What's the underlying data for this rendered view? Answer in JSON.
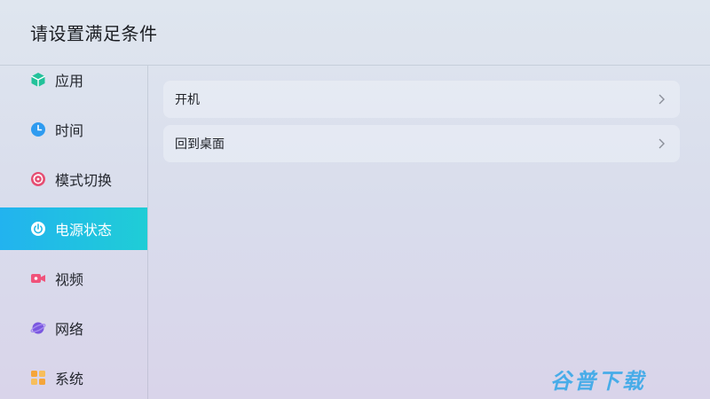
{
  "page": {
    "title": "请设置满足条件"
  },
  "sidebar": {
    "items": [
      {
        "label": "应用",
        "icon": "app-cube-icon",
        "active": false
      },
      {
        "label": "时间",
        "icon": "clock-icon",
        "active": false
      },
      {
        "label": "模式切换",
        "icon": "mode-switch-icon",
        "active": false
      },
      {
        "label": "电源状态",
        "icon": "power-icon",
        "active": true
      },
      {
        "label": "视频",
        "icon": "video-camera-icon",
        "active": false
      },
      {
        "label": "网络",
        "icon": "planet-network-icon",
        "active": false
      },
      {
        "label": "系统",
        "icon": "grid-system-icon",
        "active": false
      }
    ]
  },
  "main": {
    "options": [
      {
        "label": "开机"
      },
      {
        "label": "回到桌面"
      }
    ]
  },
  "watermark": {
    "text": "谷普下载"
  },
  "colors": {
    "active_start": "#22b3ef",
    "active_end": "#1fcdd6",
    "app_icon": "#22c29a",
    "clock_icon": "#2e9bf0",
    "mode_icon": "#e64e72",
    "video_icon": "#f0527a",
    "network_icon": "#7a57e0",
    "system_icon": "#f5a53a"
  }
}
